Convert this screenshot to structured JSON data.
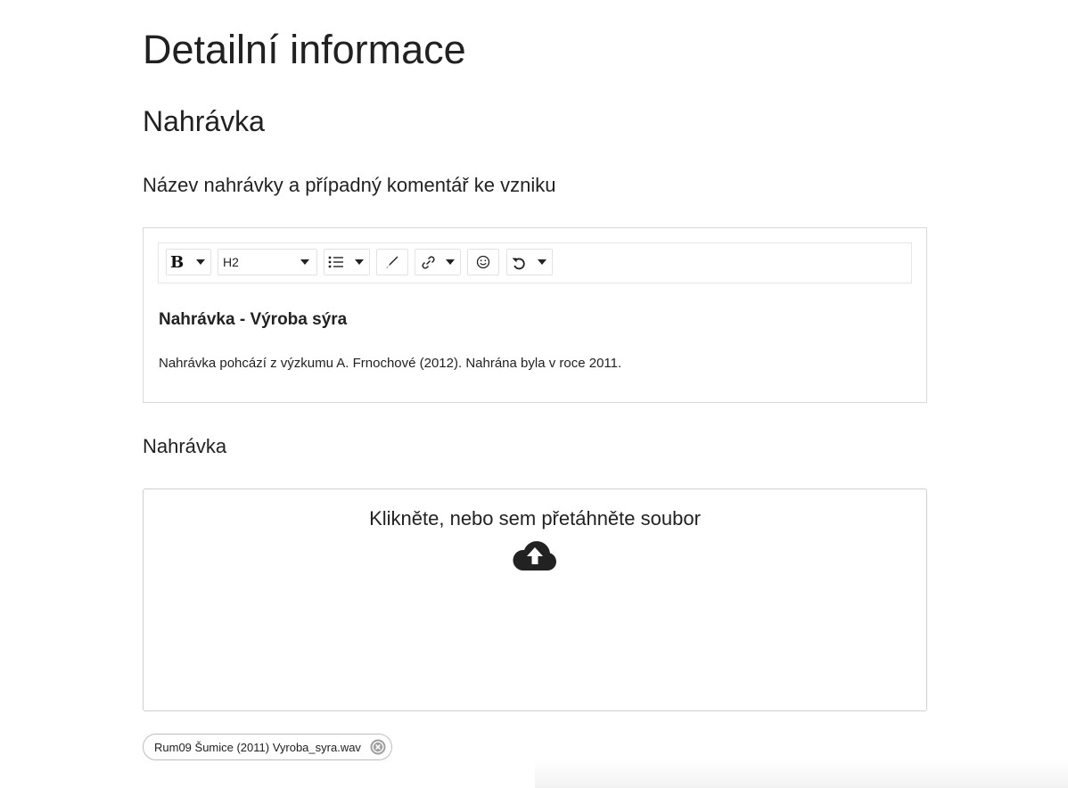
{
  "page": {
    "title": "Detailní informace",
    "section_title": "Nahrávka"
  },
  "description_field": {
    "label": "Název nahrávky a případný komentář ke vzniku",
    "toolbar": {
      "bold_label": "B",
      "heading_value": "H2",
      "icons": [
        "bold-icon",
        "list-icon",
        "pen-icon",
        "link-icon",
        "emoji-icon",
        "undo-icon"
      ]
    },
    "content": {
      "heading": "Nahrávka - Výroba sýra",
      "paragraph": "Nahrávka pohcází z výzkumu A. Frnochové (2012). Nahrána byla v roce 2011."
    }
  },
  "upload_field": {
    "label": "Nahrávka",
    "dropzone_text": "Klikněte, nebo sem přetáhněte soubor",
    "dropzone_icon": "cloud-upload-icon",
    "files": [
      {
        "name": "Rum09 Šumice (2011) Vyroba_syra.wav"
      }
    ]
  },
  "colors": {
    "text": "#222222",
    "border": "#d9d9d9",
    "background": "#ffffff"
  }
}
